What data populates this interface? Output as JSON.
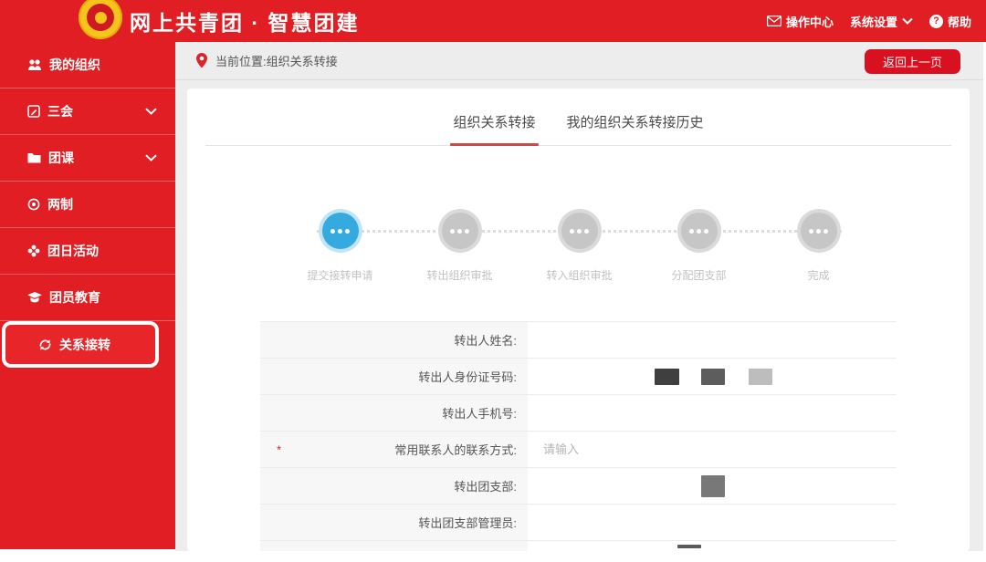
{
  "header": {
    "title": "网上共青团 · 智慧团建",
    "nav": [
      {
        "icon": "mail-icon",
        "label": "操作中心"
      },
      {
        "icon": "chevron-down-icon",
        "label": "系统设置"
      },
      {
        "icon": "help-icon",
        "label": "帮助"
      }
    ]
  },
  "sidebar": {
    "items": [
      {
        "icon": "organization-icon",
        "label": "我的组织",
        "expandable": false,
        "highlighted": false
      },
      {
        "icon": "meetings-icon",
        "label": "三会",
        "expandable": true,
        "highlighted": false
      },
      {
        "icon": "course-icon",
        "label": "团课",
        "expandable": true,
        "highlighted": false
      },
      {
        "icon": "system-icon",
        "label": "两制",
        "expandable": false,
        "highlighted": false
      },
      {
        "icon": "activity-icon",
        "label": "团日活动",
        "expandable": false,
        "highlighted": false
      },
      {
        "icon": "education-icon",
        "label": "团员教育",
        "expandable": false,
        "highlighted": false
      },
      {
        "icon": "transfer-icon",
        "label": "关系接转",
        "expandable": false,
        "highlighted": true
      }
    ]
  },
  "toolbar": {
    "breadcrumb": "当前位置:组织关系转接",
    "back_button": "返回上一页"
  },
  "tabs": [
    {
      "label": "组织关系转接",
      "active": true
    },
    {
      "label": "我的组织关系转接历史",
      "active": false
    }
  ],
  "steps": [
    {
      "label": "提交接转申请",
      "active": true
    },
    {
      "label": "转出组织审批",
      "active": false
    },
    {
      "label": "转入组织审批",
      "active": false
    },
    {
      "label": "分配团支部",
      "active": false
    },
    {
      "label": "完成",
      "active": false
    }
  ],
  "form": {
    "rows": [
      {
        "label": "转出人姓名:",
        "required": false,
        "value": "",
        "value_redacted": false
      },
      {
        "label": "转出人身份证号码:",
        "required": false,
        "value": "",
        "value_redacted": true
      },
      {
        "label": "转出人手机号:",
        "required": false,
        "value": "",
        "value_redacted": false
      },
      {
        "label": "常用联系人的联系方式:",
        "required": true,
        "value": "",
        "placeholder": "请输入",
        "value_redacted": false
      },
      {
        "label": "转出团支部:",
        "required": false,
        "value": "",
        "value_redacted": true
      },
      {
        "label": "转出团支部管理员:",
        "required": false,
        "value": "",
        "value_redacted": false
      }
    ]
  },
  "colors": {
    "brand_red": "#e11e23",
    "button_red": "#d9101f",
    "accent_blue": "#35aadf",
    "step_inactive_gray": "#c6c6c6",
    "tab_underline_red": "#c94b47"
  }
}
